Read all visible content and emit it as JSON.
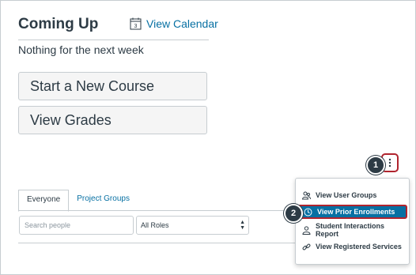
{
  "coming_up": {
    "title": "Coming Up",
    "calendar_link": "View Calendar",
    "calendar_day": "3",
    "empty_text": "Nothing for the next week"
  },
  "actions": {
    "new_course": "Start a New Course",
    "view_grades": "View Grades"
  },
  "tabs": [
    {
      "label": "Everyone",
      "active": true
    },
    {
      "label": "Project Groups",
      "active": false
    }
  ],
  "search": {
    "placeholder": "Search people"
  },
  "roles": {
    "selected": "All Roles"
  },
  "menu": {
    "items": [
      {
        "label": "View User Groups",
        "icon": "users-icon"
      },
      {
        "label": "View Prior Enrollments",
        "icon": "clock-icon"
      },
      {
        "label": "Student Interactions Report",
        "icon": "user-icon"
      },
      {
        "label": "View Registered Services",
        "icon": "link-icon"
      }
    ]
  },
  "badges": {
    "first": "1",
    "second": "2"
  },
  "colors": {
    "link": "#0770a3",
    "highlight": "#b0242e",
    "text": "#2d3b45"
  }
}
